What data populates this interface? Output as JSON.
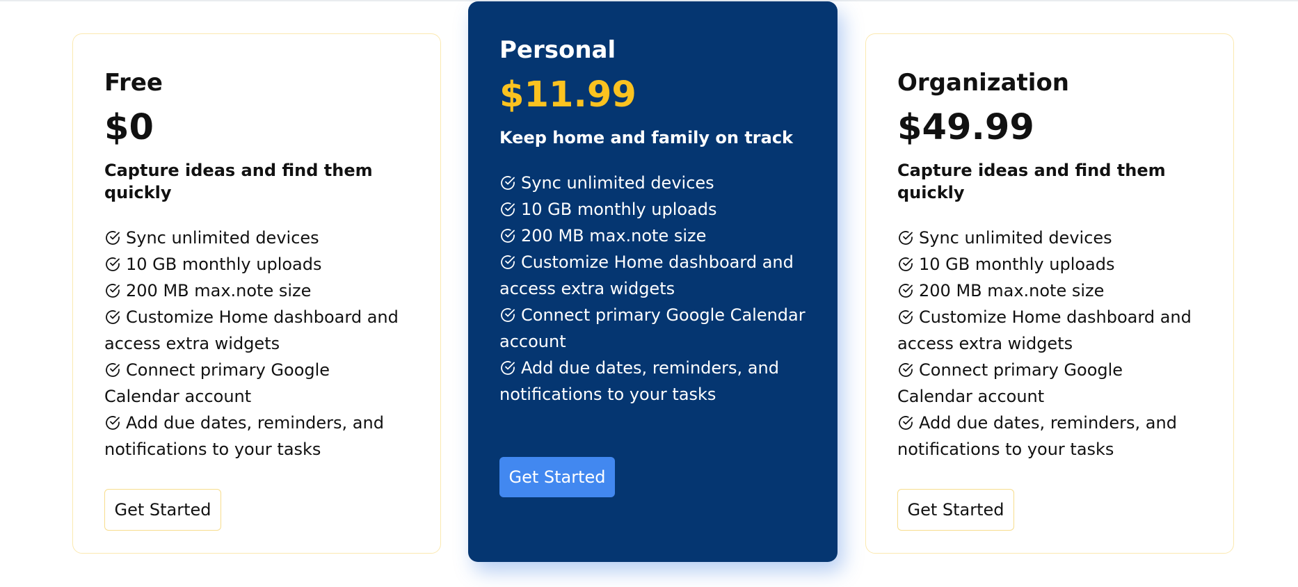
{
  "plans": [
    {
      "name": "Free",
      "price": "$0",
      "tagline": "Capture ideas and find them quickly",
      "features": [
        "Sync unlimited devices",
        "10 GB monthly uploads",
        "200 MB max.note size",
        "Customize Home dashboard and access extra widgets",
        "Connect primary Google Calendar account",
        "Add due dates, reminders, and notifications to your tasks"
      ],
      "cta_label": "Get Started"
    },
    {
      "name": "Personal",
      "price": "$11.99",
      "tagline": "Keep home and family on track",
      "features": [
        "Sync unlimited devices",
        "10 GB monthly uploads",
        "200 MB max.note size",
        "Customize Home dashboard and access extra widgets",
        "Connect primary Google Calendar account",
        "Add due dates, reminders, and notifications to your tasks"
      ],
      "cta_label": "Get Started"
    },
    {
      "name": "Organization",
      "price": "$49.99",
      "tagline": "Capture ideas and find them quickly",
      "features": [
        "Sync unlimited devices",
        "10 GB monthly uploads",
        "200 MB max.note size",
        "Customize Home dashboard and access extra widgets",
        "Connect primary Google Calendar account",
        "Add due dates, reminders, and notifications to your tasks"
      ],
      "cta_label": "Get Started"
    }
  ],
  "icons": {
    "feature_check": "check-circle-icon"
  },
  "colors": {
    "featured_background": "#053671",
    "featured_price": "#fbc220",
    "primary_button": "#4288f0",
    "card_border": "#fbe9b0"
  }
}
